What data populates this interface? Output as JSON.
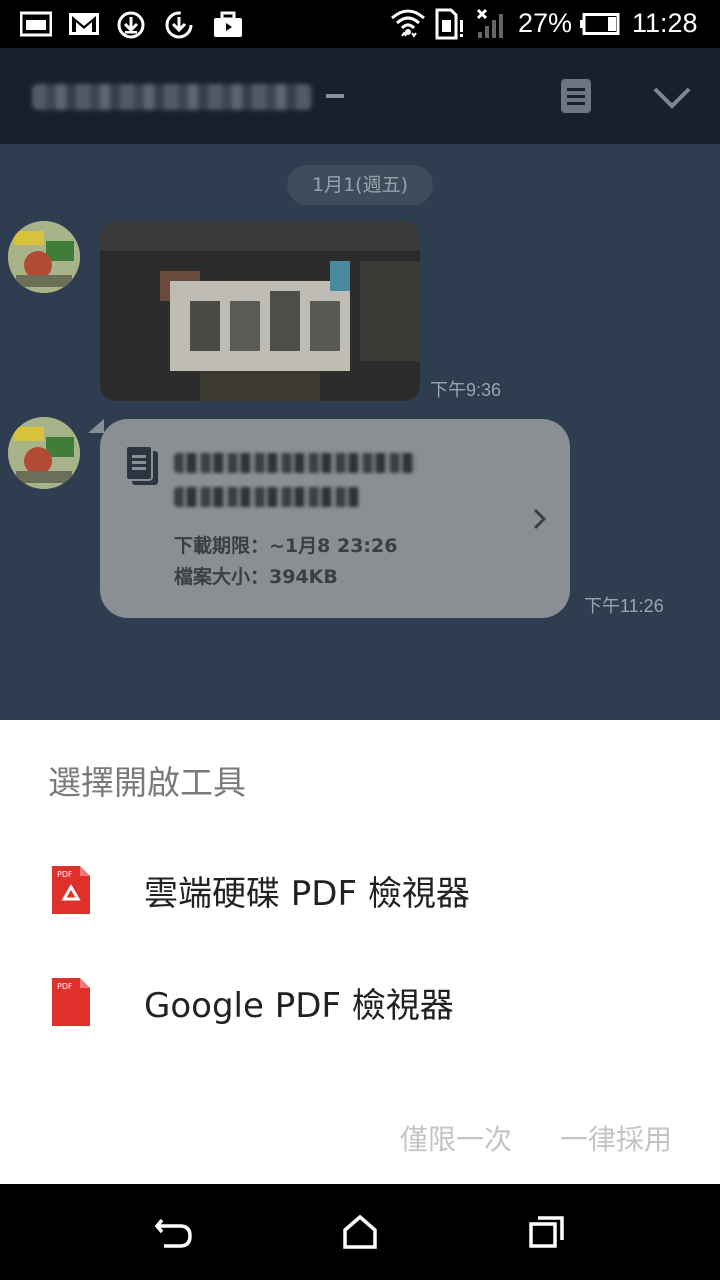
{
  "status_bar": {
    "battery_percent": "27%",
    "time": "11:28",
    "notification_icons": [
      "image-icon",
      "gmail-icon",
      "download-icon",
      "sync-download-icon",
      "briefcase-icon"
    ],
    "system_icons": [
      "wifi-icon",
      "sim-icon",
      "signal-icon",
      "battery-icon"
    ]
  },
  "chat": {
    "header": {
      "title_dash": "-",
      "icons": [
        "note-icon",
        "chevron-down-icon"
      ]
    },
    "date_label": "1月1(週五)",
    "messages": [
      {
        "type": "image",
        "time": "下午9:36"
      },
      {
        "type": "file",
        "time": "下午11:26",
        "download_limit_label": "下載期限：",
        "download_limit_value": "~1月8 23:26",
        "file_size_label": "檔案大小：",
        "file_size_value": "394KB"
      }
    ]
  },
  "chooser": {
    "title": "選擇開啟工具",
    "apps": [
      {
        "label": "雲端硬碟 PDF 檢視器",
        "icon": "drive-pdf-icon",
        "icon_text": "PDF"
      },
      {
        "label": "Google PDF 檢視器",
        "icon": "google-pdf-icon",
        "icon_text": "PDF"
      }
    ],
    "just_once": "僅限一次",
    "always": "一律採用",
    "button_color": "#c4c4c4"
  },
  "nav_bar": {
    "icons": [
      "back-icon",
      "home-icon",
      "recents-icon"
    ]
  },
  "colors": {
    "chat_bg": "#2e3d4f",
    "header_bg": "#17202c",
    "pdf_red": "#e0302b"
  }
}
